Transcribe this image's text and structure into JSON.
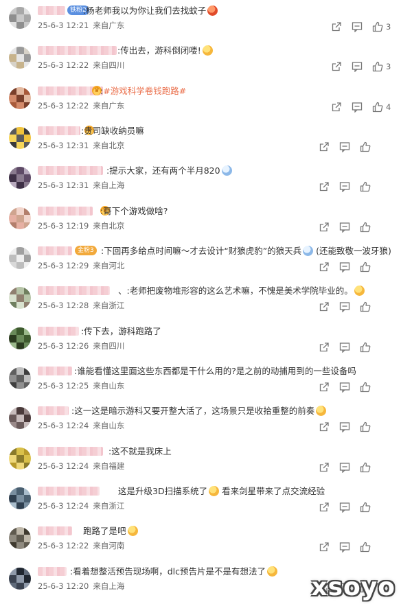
{
  "comments": [
    {
      "text": ":杨老师我以为你让我们去找蚊子",
      "date": "25-6-3 12:21",
      "location": "来自广东",
      "likes": "3",
      "avatar_colors": [
        "#c9c9c9",
        "#a8a8a8",
        "#e0e0e0",
        "#8f8f8f"
      ],
      "badge": "铁粉2",
      "emoji": "red"
    },
    {
      "text": ":传出去，游科倒闭喽!",
      "date": "25-6-3 12:22",
      "location": "来自四川",
      "likes": "3",
      "avatar_colors": [
        "#c7b38c",
        "#e6e6e6",
        "#9a9a9a",
        "#d7d2c8"
      ],
      "emoji": "yellow"
    },
    {
      "text_prefix": ":",
      "hashtag": "#游戏科学卷钱跑路#",
      "date": "25-6-3 12:22",
      "location": "来自广东",
      "likes": "4",
      "avatar_colors": [
        "#a85a3a",
        "#d38a6a",
        "#7a3f2a",
        "#e3b9a0"
      ],
      "crown": true
    },
    {
      "text": ":贵司缺收纳员嘛",
      "date": "25-6-3 12:31",
      "location": "来自北京",
      "likes": "",
      "avatar_colors": [
        "#f0c33c",
        "#3a3a3a",
        "#f7d65a",
        "#5a5a5a"
      ],
      "crown": true
    },
    {
      "text": ":提示大家，还有两个半月820",
      "date": "25-6-3 12:31",
      "location": "来自上海",
      "likes": "",
      "avatar_colors": [
        "#8a7b8f",
        "#5e4a66",
        "#b7a9bd",
        "#3e3046"
      ],
      "emoji": "blue"
    },
    {
      "text": ":哥下个游戏做啥?",
      "date": "25-6-3 12:19",
      "location": "来自北京",
      "likes": "",
      "avatar_colors": [
        "#e6b0a3",
        "#cfa48f",
        "#f2d5cc",
        "#b37f6c"
      ],
      "crown": true
    },
    {
      "text": ":下回再多给点时间嘛～才去设计“财狼虎豹”的狼天兵",
      "text_suffix": "(还能致敬一波牙狼)",
      "date": "25-6-3 12:29",
      "location": "来自河北",
      "likes": "",
      "avatar_colors": [
        "#d9d9d9",
        "#bdbdbd",
        "#efefef",
        "#a0a0a0"
      ],
      "badge": "金粉3",
      "emoji": "blue"
    },
    {
      "text": "、:老师把废物堆形容的这么艺术嘛，不愧是美术学院毕业的。",
      "date": "25-6-3 12:28",
      "location": "来自浙江",
      "likes": "",
      "avatar_colors": [
        "#b7c4a8",
        "#6f7f5f",
        "#d9e2cf",
        "#8f7f6f"
      ],
      "emoji": "yellow"
    },
    {
      "text": ":传下去，游科跑路了",
      "date": "25-6-3 12:26",
      "location": "来自四川",
      "likes": "",
      "avatar_colors": [
        "#6a8a5a",
        "#3e5a2e",
        "#9ab88a",
        "#2a3a1e"
      ]
    },
    {
      "text": ":谁能看懂这里面这些东西都是干什么用的?是之前的动捕用到的一些设备吗",
      "date": "25-6-3 12:25",
      "location": "来自山东",
      "likes": "",
      "avatar_colors": [
        "#8f8f8f",
        "#5f5f5f",
        "#bfbfbf",
        "#3f3f3f"
      ]
    },
    {
      "text": ":这一这是暗示游科又要开整大活了，这场景只是收拾重整的前奏",
      "date": "25-6-3 12:24",
      "location": "来自山东",
      "likes": "",
      "avatar_colors": [
        "#9a8a8a",
        "#6a5a5a",
        "#c8bcbc",
        "#4a3a3a"
      ],
      "emoji": "yellow"
    },
    {
      "text": ":这不就是我床上",
      "date": "25-6-3 12:24",
      "location": "来自福建",
      "likes": "",
      "avatar_colors": [
        "#d9c04a",
        "#b89a2a",
        "#efd87a",
        "#8a7a2a"
      ]
    },
    {
      "text": "这是升级3D扫描系统了",
      "text_suffix": "看来剑星带来了点交流经验",
      "date": "25-6-3 12:24",
      "location": "来自浙江",
      "likes": "",
      "avatar_colors": [
        "#7a8fa0",
        "#4a5f70",
        "#a8bccb",
        "#2f3f4f"
      ],
      "emoji": "yellow"
    },
    {
      "text": "跑路了是吧",
      "date": "25-6-3 12:22",
      "location": "来自河南",
      "likes": "",
      "avatar_colors": [
        "#8f8a7f",
        "#5f5a4f",
        "#bfb8aa",
        "#3f3a2f"
      ],
      "emoji": "yellow"
    },
    {
      "text": ":看着想整活预告现场啊，dlc预告片是不是有想法了",
      "date": "25-6-3 12:20",
      "location": "来自上海",
      "likes": "",
      "avatar_colors": [
        "#5f6a7a",
        "#3a4250",
        "#8f9aaa",
        "#1f2630"
      ],
      "emoji": "yellow"
    }
  ],
  "watermark": "xsoyo"
}
